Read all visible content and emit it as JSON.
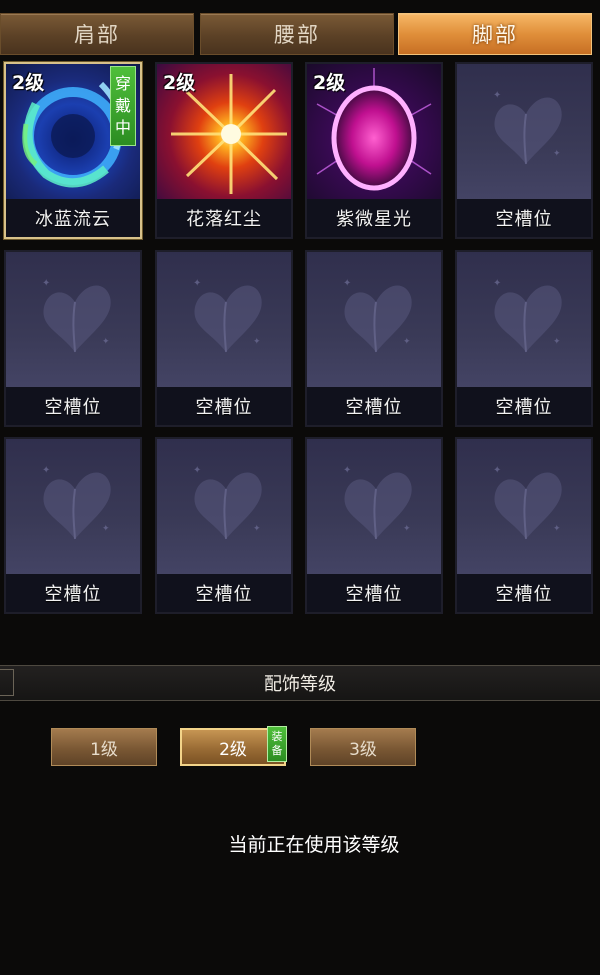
{
  "tabs": [
    {
      "label": "肩部",
      "active": false
    },
    {
      "label": "腰部",
      "active": false
    },
    {
      "label": "脚部",
      "active": true
    }
  ],
  "slots": [
    {
      "name": "冰蓝流云",
      "level": "2级",
      "art": "ice-swirl",
      "badge": [
        "穿",
        "戴",
        "中"
      ]
    },
    {
      "name": "花落红尘",
      "level": "2级",
      "art": "red-burst"
    },
    {
      "name": "紫微星光",
      "level": "2级",
      "art": "purple-orb"
    },
    {
      "name": "空槽位"
    },
    {
      "name": "空槽位"
    },
    {
      "name": "空槽位"
    },
    {
      "name": "空槽位"
    },
    {
      "name": "空槽位"
    },
    {
      "name": "空槽位"
    },
    {
      "name": "空槽位"
    },
    {
      "name": "空槽位"
    },
    {
      "name": "空槽位"
    }
  ],
  "section": {
    "title": "配饰等级"
  },
  "levels": [
    {
      "label": "1级",
      "active": false
    },
    {
      "label": "2级",
      "active": true,
      "badge": [
        "装",
        "备"
      ]
    },
    {
      "label": "3级",
      "active": false
    }
  ],
  "status": "当前正在使用该等级"
}
